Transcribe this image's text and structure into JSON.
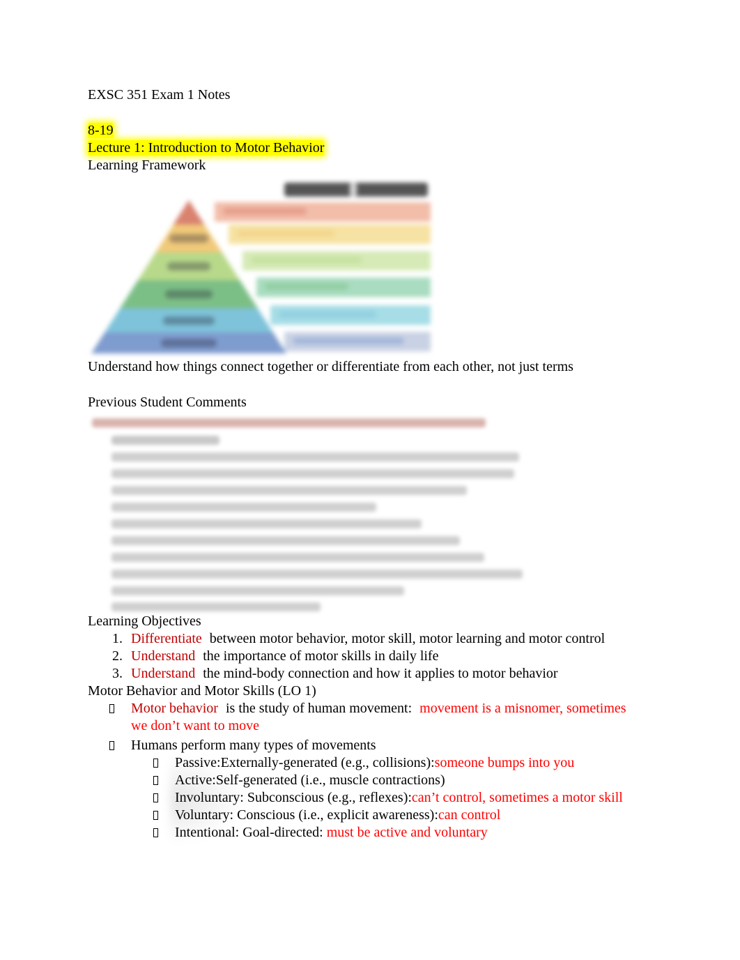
{
  "document": {
    "title": "EXSC 351 Exam 1 Notes",
    "date": "8-19",
    "lecture_title": "Lecture 1: Introduction to Motor Behavior",
    "learning_framework_heading": "Learning Framework",
    "figure": {
      "description": "Blurred pyramid diagram (taxonomy) with colored levels and description bars",
      "band_colors": [
        "#d9826f",
        "#f1c97a",
        "#b8d98a",
        "#7cbf86",
        "#7ec3da",
        "#7f9ccf"
      ],
      "desc_colors": [
        "#f2bda9",
        "#f6e2a2",
        "#d6eab7",
        "#a9dcc0",
        "#a6dde6",
        "#c9d2e4"
      ]
    },
    "framework_note": "Understand how things connect together or differentiate from each other, not just terms",
    "previous_comments_heading": "Previous Student Comments",
    "previous_comments_blurred": true,
    "learning_objectives_heading": "Learning Objectives",
    "learning_objectives": [
      {
        "num": "1.",
        "verb": "Differentiate",
        "text": "between motor behavior, motor skill, motor learning and motor control"
      },
      {
        "num": "2.",
        "verb": "Understand",
        "text": "the importance of motor skills in daily life"
      },
      {
        "num": "3.",
        "verb": "Understand",
        "text": "the mind-body connection and how it applies to motor behavior"
      }
    ],
    "section_heading": "Motor Behavior and Motor Skills (LO 1)",
    "bullets": [
      {
        "term": "Motor behavior",
        "text": "is the study of human movement:",
        "note_line1": "movement is a misnomer, sometimes",
        "note_line2": "we don’t want to move"
      },
      {
        "text": "Humans perform many types of movements"
      }
    ],
    "movement_types": [
      {
        "label": "Passive:",
        "desc": "Externally-generated (e.g., collisions):",
        "note": "someone bumps into you"
      },
      {
        "label": "Active:",
        "desc": "Self-generated (i.e., muscle contractions)",
        "note": ""
      },
      {
        "label": "Involuntary:",
        "desc": "Subconscious (e.g., reflexes):",
        "note": "can’t control, sometimes a motor skill"
      },
      {
        "label": "Voluntary:",
        "desc": "Conscious (i.e., explicit awareness):",
        "note": "can control"
      },
      {
        "label": "Intentional:",
        "desc": "Goal-directed:",
        "note": "must be active and voluntary"
      }
    ]
  },
  "colors": {
    "highlight": "#ffff00",
    "term_red": "#c00000",
    "annotation_red": "#ff0000",
    "text": "#000000"
  }
}
